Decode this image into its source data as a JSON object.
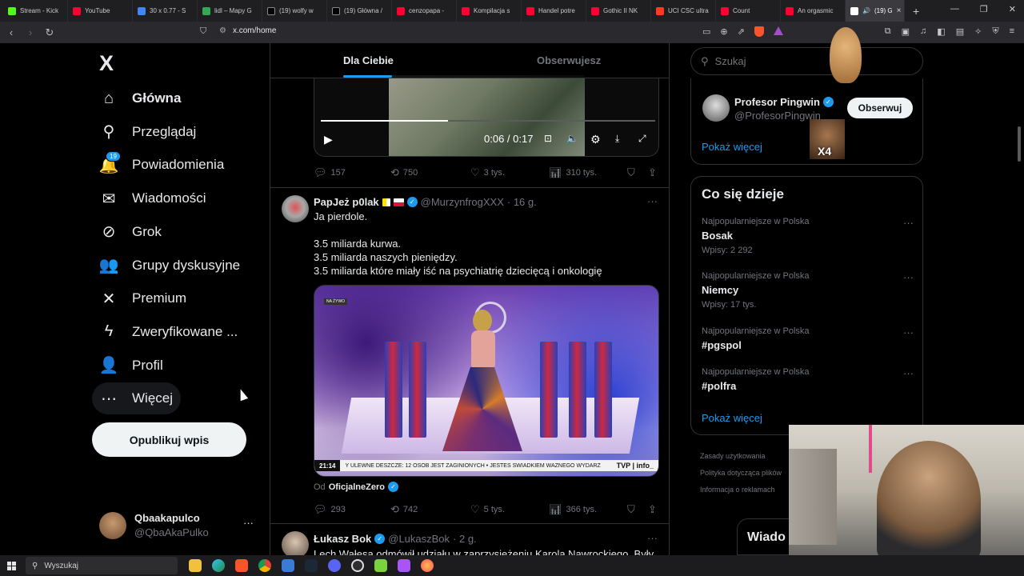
{
  "browser": {
    "tabs": [
      {
        "label": "Stream - Kick",
        "color": "#53fc18"
      },
      {
        "label": "YouTube",
        "color": "#ff0033"
      },
      {
        "label": "30 x 0.77 - S",
        "color": "#4285f4"
      },
      {
        "label": "lidl – Mapy G",
        "color": "#34a853"
      },
      {
        "label": "(19) wolfy w",
        "color": "#000000"
      },
      {
        "label": "(19) Główna /",
        "color": "#000000"
      },
      {
        "label": "cenzopapa -",
        "color": "#ff0033"
      },
      {
        "label": "Kompilacja s",
        "color": "#ff0033"
      },
      {
        "label": "Handel potre",
        "color": "#ff0033"
      },
      {
        "label": "Gothic II NK",
        "color": "#ff0033"
      },
      {
        "label": "UCI CSC ultra",
        "color": "#ff3b1f"
      },
      {
        "label": "Count",
        "color": "#ff0033"
      },
      {
        "label": "An orgasmic",
        "color": "#ff0033"
      }
    ],
    "active_tab": {
      "label": "(19) G",
      "close": "×"
    },
    "new_tab": "+",
    "url": "x.com/home"
  },
  "nav": {
    "logo": "X",
    "items": [
      {
        "label": "Główna",
        "icon": "home-icon",
        "glyph": "⌂"
      },
      {
        "label": "Przeglądaj",
        "icon": "search-icon",
        "glyph": "⚲"
      },
      {
        "label": "Powiadomienia",
        "icon": "bell-icon",
        "glyph": "🔔",
        "badge": "19"
      },
      {
        "label": "Wiadomości",
        "icon": "mail-icon",
        "glyph": "✉"
      },
      {
        "label": "Grok",
        "icon": "grok-icon",
        "glyph": "⊘"
      },
      {
        "label": "Grupy dyskusyjne",
        "icon": "communities-icon",
        "glyph": "👥"
      },
      {
        "label": "Premium",
        "icon": "x-premium-icon",
        "glyph": "✕"
      },
      {
        "label": "Zweryfikowane ...",
        "icon": "lightning-icon",
        "glyph": "ϟ"
      },
      {
        "label": "Profil",
        "icon": "profile-icon",
        "glyph": "👤"
      },
      {
        "label": "Więcej",
        "icon": "more-circle-icon",
        "glyph": "⋯"
      }
    ],
    "post_button": "Opublikuj wpis",
    "account": {
      "name": "Qbaakapulco",
      "handle": "@QbaAkaPulko",
      "more": "···"
    }
  },
  "timeline": {
    "tabs": {
      "for_you": "Dla Ciebie",
      "following": "Obserwujesz"
    },
    "video1": {
      "time": "0:06 / 0:17",
      "progress": 0.38
    },
    "post1_actions": {
      "replies": "157",
      "reposts": "750",
      "likes": "3 tys.",
      "views": "310 tys."
    },
    "post2": {
      "name": "PapJeż p0lak",
      "handle": "@MurzynfrogXXX",
      "time": "· 16 g.",
      "lines": [
        "Ja pierdole.",
        "",
        "3.5 miliarda kurwa.",
        "3.5 miliarda naszych pieniędzy.",
        "3.5 miliarda które miały iść na psychiatrię dziecięcą i onkologię"
      ],
      "media": {
        "live": "NA ŻYWO",
        "clock": "21:14",
        "ticker": "Y ULEWNE DESZCZE: 12 OSÓB JEST ZAGINIONYCH • JESTEŚ ŚWIADKIEM WAŻNEGO WYDARZ",
        "channel": "TVP | info_"
      },
      "source_prefix": "Od",
      "source_name": "OficjalneZero",
      "actions": {
        "replies": "293",
        "reposts": "742",
        "likes": "5 tys.",
        "views": "366 tys."
      }
    },
    "post3": {
      "name": "Łukasz Bok",
      "handle": "@LukaszBok",
      "time": "· 2 g.",
      "text": "Lech Wałęsa odmówił udziału w zaprzysiężeniu Karola Nawrockiego. Były"
    }
  },
  "sidebar": {
    "search_placeholder": "Szukaj",
    "who_to_follow": {
      "name": "Profesor Pingwin",
      "handle": "@ProfesorPingwin",
      "follow": "Obserwuj",
      "show_more": "Pokaż więcej",
      "overlay": "X4"
    },
    "trends": {
      "title": "Co się dzieje",
      "items": [
        {
          "context": "Najpopularniejsze w Polska",
          "name": "Bosak",
          "count": "Wpisy: 2 292"
        },
        {
          "context": "Najpopularniejsze w Polska",
          "name": "Niemcy",
          "count": "Wpisy: 17 tys."
        },
        {
          "context": "Najpopularniejsze w Polska",
          "name": "#pgspol",
          "count": ""
        },
        {
          "context": "Najpopularniejsze w Polska",
          "name": "#polfra",
          "count": ""
        }
      ],
      "show_more": "Pokaż więcej"
    },
    "footer": [
      "Zasady użytkowania",
      "Polityka dotycząca plików",
      "Informacja o reklamach"
    ],
    "messages_popup": "Wiado"
  },
  "taskbar": {
    "search": "Wyszukaj"
  }
}
